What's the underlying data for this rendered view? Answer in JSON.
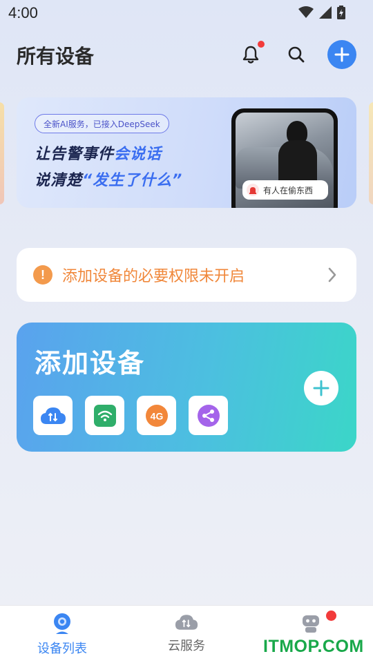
{
  "status_bar": {
    "time": "4:00"
  },
  "header": {
    "title": "所有设备"
  },
  "banner": {
    "tag": "全新AI服务，已接入DeepSeek",
    "line1_a": "让告警事件",
    "line1_b": "会说话",
    "line2_a": "说清楚",
    "line2_b": "“发生了什么”",
    "alert_text": "有人在偷东西"
  },
  "notice": {
    "text": "添加设备的必要权限未开启"
  },
  "add_device": {
    "title": "添加设备",
    "methods": [
      {
        "icon": "cloud-icon"
      },
      {
        "icon": "wifi-icon"
      },
      {
        "icon": "4g-icon",
        "label": "4G"
      },
      {
        "icon": "share-icon"
      }
    ]
  },
  "bottom_nav": {
    "items": [
      {
        "label": "设备列表",
        "active": true
      },
      {
        "label": "云服务",
        "active": false
      },
      {
        "label": "",
        "active": false
      }
    ]
  },
  "watermark": "ITMOP.COM",
  "colors": {
    "accent": "#3b86f2",
    "warning": "#f0873a",
    "badge": "#f23b3b"
  }
}
